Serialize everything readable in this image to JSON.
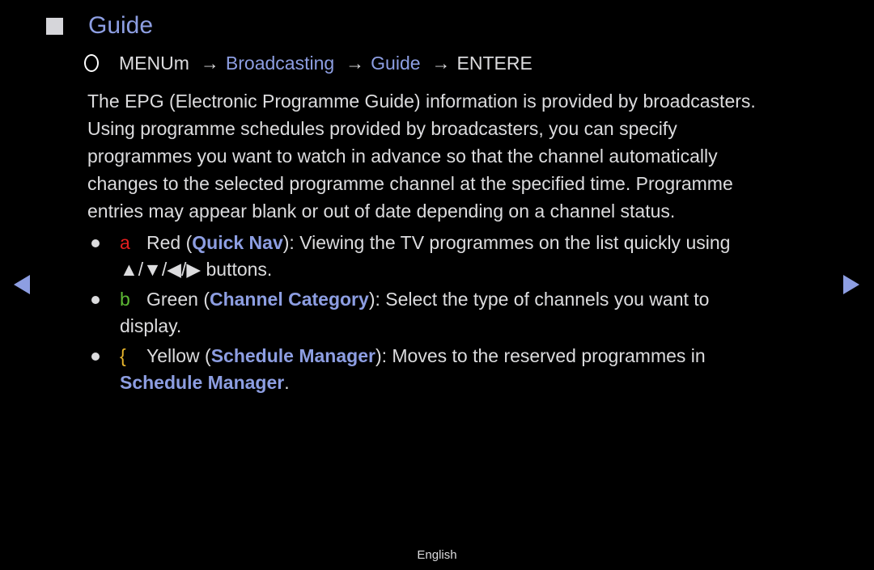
{
  "header": {
    "title": "Guide",
    "title_icon": "square-icon"
  },
  "path": {
    "icon": "circle-o-icon",
    "menu_label": "MENU",
    "menu_suffix": "m",
    "arrow": "→",
    "steps": [
      "Broadcasting",
      "Guide"
    ],
    "enter_label": "ENTER",
    "enter_suffix": "E"
  },
  "description": {
    "lines": [
      "The EPG (Electronic Programme Guide) information is provided by broadcasters.",
      "Using programme schedules provided by broadcasters, you can specify",
      "programmes you want to watch in advance so that the channel automatically",
      "changes to the selected programme channel at the specified time. Programme",
      "entries may appear blank or out of date depending on a channel status."
    ]
  },
  "bullets": [
    {
      "key_glyph": "a",
      "key_color": "#e41e1e",
      "color_name": "Red (",
      "feature": "Quick Nav",
      "text_after": "): Viewing the TV programmes on the list quickly using",
      "line2": "▲/▼/◀/▶ buttons."
    },
    {
      "key_glyph": "b",
      "key_color": "#5db934",
      "color_name": "Green (",
      "feature": "Channel Category",
      "text_after": "): Select the type of channels you want to",
      "line2": "display."
    },
    {
      "key_glyph": "{",
      "key_color": "#e9b62c",
      "color_name": "Yellow (",
      "feature": "Schedule Manager",
      "text_after": "): Moves to the reserved programmes in",
      "line2_link": "Schedule Manager",
      "line2_end": "."
    }
  ],
  "navigation": {
    "prev_icon": "triangle-left-icon",
    "next_icon": "triangle-right-icon"
  },
  "footer": {
    "language": "English"
  },
  "colors": {
    "background": "#000000",
    "accent": "#8d9ee2",
    "text": "#dcdcde",
    "red_key": "#e41e1e",
    "green_key": "#5db934",
    "yellow_key": "#e9b62c"
  }
}
